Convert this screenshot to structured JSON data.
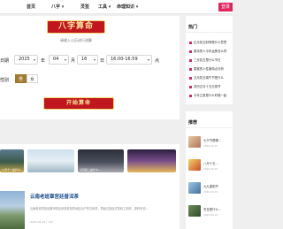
{
  "nav": {
    "items": [
      "首页",
      "八字 ▾",
      "灵签",
      "工具 ▾",
      "命理知识 ▾"
    ],
    "login": "登录"
  },
  "form": {
    "title": "八字算命",
    "subtitle": "请输入公历进行测算",
    "date_label": "日期",
    "year": "2025",
    "year_unit": "年",
    "month": "04",
    "month_unit": "月",
    "day": "16",
    "day_unit": "日",
    "time": "16:00-16:59",
    "time_unit": "点",
    "gender_label": "性别",
    "gender_male": "男",
    "gender_female": "女",
    "submit": "开始算命"
  },
  "feed": {
    "thumb_titles": [
      "八月十一是什么...",
      "",
      "七月初二是什么...",
      ""
    ],
    "article": {
      "title": "云南老班章宫廷普洱茶",
      "text": "云南老班章宫廷普洱茶由来是老班章地区出产的古树茶，再经过宫廷式的精工制作，原料来自...",
      "meta": "2025-04-15   |   153"
    }
  },
  "sidebar": {
    "hot_title": "热门",
    "hot_items": [
      "正月初五财神是什么意思",
      "属鸡的人今年运势怎么样",
      "三月初五是什么节日",
      "属猴的人性格特点分析",
      "五月初五端午节是什么",
      "农历正月十五元宵节",
      "今年立夏是什么时候一起"
    ],
    "rec_title": "推荐",
    "rec_items": [
      {
        "title": "七夕节是哪...",
        "date": "2025-04-15"
      },
      {
        "title": "八月十五...",
        "date": "2025-04-15"
      },
      {
        "title": "九九重阳节",
        "date": "2025-04-15"
      },
      {
        "title": "冬至是什么...",
        "date": "2025-04-15"
      }
    ]
  },
  "colors": {
    "accent_red": "#c0161e",
    "gold": "#f5d36b",
    "brand_pink": "#e0245e",
    "gender_active": "#a07a33"
  }
}
